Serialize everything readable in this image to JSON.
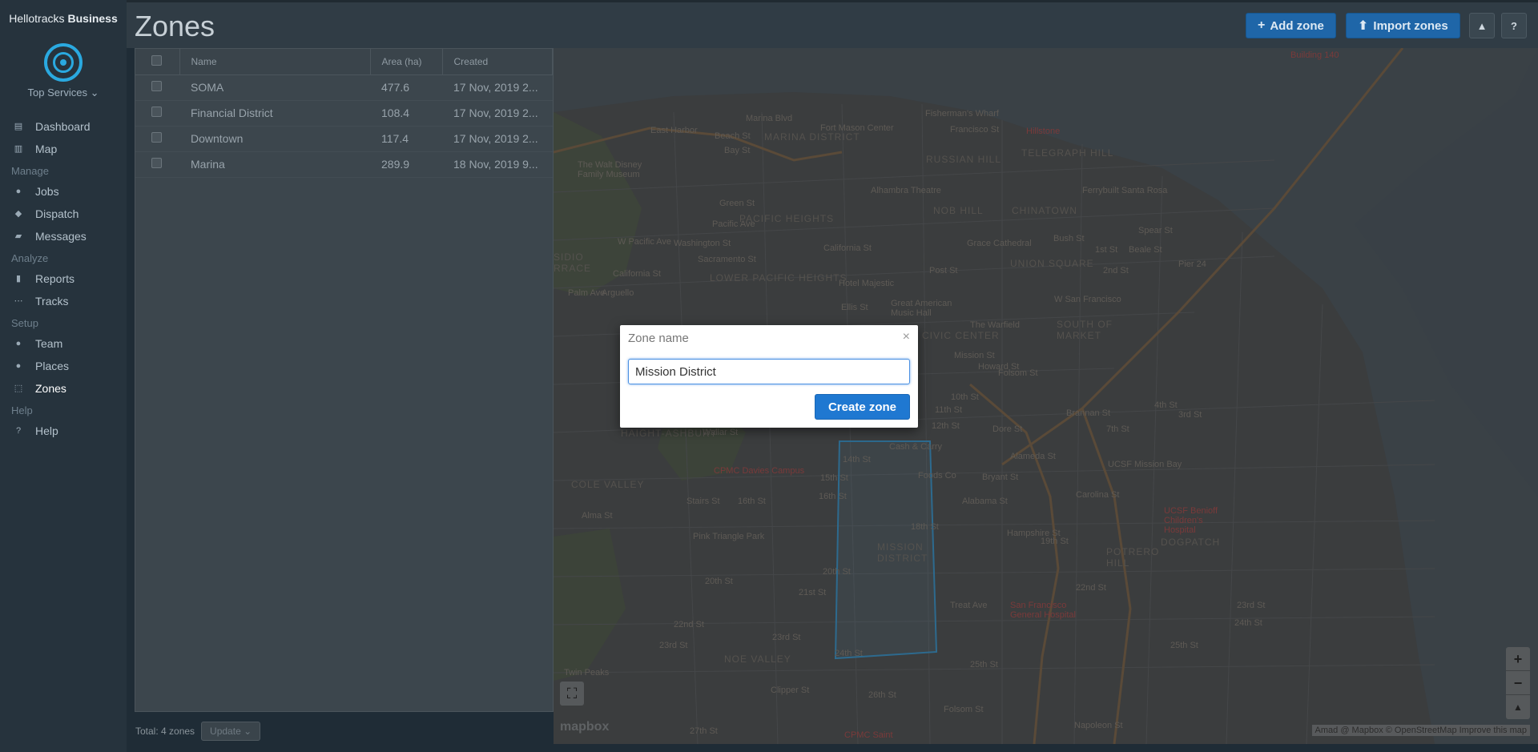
{
  "brand": {
    "prefix": "Hellotracks",
    "suffix": "Business"
  },
  "org": {
    "name": "Top Services ⌄"
  },
  "sidebar": {
    "sections": [
      {
        "label": "",
        "items": [
          {
            "label": "Dashboard",
            "icon": "dashboard-icon"
          },
          {
            "label": "Map",
            "icon": "map-icon"
          }
        ]
      },
      {
        "label": "Manage",
        "items": [
          {
            "label": "Jobs",
            "icon": "jobs-icon"
          },
          {
            "label": "Dispatch",
            "icon": "dispatch-icon"
          },
          {
            "label": "Messages",
            "icon": "messages-icon"
          }
        ]
      },
      {
        "label": "Analyze",
        "items": [
          {
            "label": "Reports",
            "icon": "reports-icon"
          },
          {
            "label": "Tracks",
            "icon": "tracks-icon"
          }
        ]
      },
      {
        "label": "Setup",
        "items": [
          {
            "label": "Team",
            "icon": "team-icon"
          },
          {
            "label": "Places",
            "icon": "places-icon"
          },
          {
            "label": "Zones",
            "icon": "zones-icon",
            "active": true
          }
        ]
      },
      {
        "label": "Help",
        "items": [
          {
            "label": "Help",
            "icon": "help-icon"
          }
        ]
      }
    ]
  },
  "header": {
    "title": "Zones",
    "add_zone": "Add zone",
    "import_zones": "Import zones",
    "bell_icon": "bell-icon",
    "help_label": "?"
  },
  "table": {
    "columns": [
      "Name",
      "Area (ha)",
      "Created"
    ],
    "rows": [
      {
        "name": "SOMA",
        "area": "477.6",
        "created": "17 Nov, 2019 2..."
      },
      {
        "name": "Financial District",
        "area": "108.4",
        "created": "17 Nov, 2019 2..."
      },
      {
        "name": "Downtown",
        "area": "117.4",
        "created": "17 Nov, 2019 2..."
      },
      {
        "name": "Marina",
        "area": "289.9",
        "created": "18 Nov, 2019 9..."
      }
    ],
    "total": "Total: 4 zones",
    "update": "Update ⌄"
  },
  "map": {
    "labels": {
      "marina_blvd": "Marina Blvd",
      "marina_district": "MARINA DISTRICT",
      "fort_mason": "Fort Mason Center",
      "fishermans_wharf": "Fisherman's Wharf",
      "francisco_st": "Francisco St",
      "hillstone": "Hillstone",
      "telegraph_hill": "TELEGRAPH HILL",
      "russian_hill": "RUSSIAN HILL",
      "east_harbor": "East Harbor",
      "beach_st": "Beach St",
      "bay_st": "Bay St",
      "disney_museum": "The Walt Disney Family Museum",
      "green_st": "Green St",
      "pacific_heights": "PACIFIC HEIGHTS",
      "nob_hill": "NOB HILL",
      "chinatown": "CHINATOWN",
      "alhambra": "Alhambra Theatre",
      "pacific_ave": "Pacific Ave",
      "washington_st": "Washington St",
      "sacramento_st": "Sacramento St",
      "w_pacific_ave": "W Pacific Ave",
      "california_st": "California St",
      "california_st2": "California St",
      "grace_cathedral": "Grace Cathedral",
      "bush_st": "Bush St",
      "lower_pac": "LOWER PACIFIC HEIGHTS",
      "union_square": "UNION SQUARE",
      "post_st": "Post St",
      "hotel_majestic": "Hotel Majestic",
      "ellis_st": "Ellis St",
      "great_american": "Great American Music Hall",
      "the_warfield": "The Warfield",
      "south_of_market": "SOUTH OF MARKET",
      "w_san_francisco": "W San Francisco",
      "civic_center": "CIVIC CENTER",
      "ferry_santa_rosa": "Ferrybuilt Santa Rosa",
      "spear_st": "Spear St",
      "beale_st": "Beale St",
      "pier24": "Pier 24",
      "building140": "Building 140",
      "haight_ashbury": "HAIGHT-ASHBURY",
      "cole_valley": "COLE VALLEY",
      "cpmc_davies": "CPMC Davies Campus",
      "wallar_st": "Wallar St",
      "cash_carry": "Cash & Carry",
      "foods_co": "Foods Co",
      "alameda_st": "Alameda St",
      "fourteenth_st": "14th St",
      "fifteenth_st": "15th St",
      "sixteenth_st": "16th St",
      "sixteenth_st2": "16th St",
      "eighteenth_st": "18th St",
      "twentieth_st": "20th St",
      "twentieth_st2": "20th St",
      "twentyfirst_st": "21st St",
      "twentysecond_st": "22nd St",
      "twentythird_st": "23rd St",
      "twentythird_st2": "23rd St",
      "twentyfourth_st": "24th St",
      "twentyfifth_st": "25th St",
      "twentysixth_st": "26th St",
      "twentyseventh_st": "27th St",
      "mission_district": "MISSION DISTRICT",
      "pink_triangle": "Pink Triangle Park",
      "alma_st": "Alma St",
      "noe_valley": "NOE VALLEY",
      "twin_peaks": "Twin Peaks",
      "clipper_st": "Clipper St",
      "cpmc_saint": "CPMC Saint",
      "ucsf_mission_bay": "UCSF Mission Bay",
      "ucsf_benioff": "UCSF Benioff Children's Hospital",
      "dogpatch": "DOGPATCH",
      "potrero_hill": "POTRERO HILL",
      "sf_general": "San Francisco General Hospital",
      "nineteenth_st": "19th St",
      "twentysecond_st2": "22nd St",
      "twentythird_st3": "23rd St",
      "twentyfourth_st2": "24th St",
      "twentyfifth_st2": "25th St",
      "third_st": "3rd St",
      "fourth_st": "4th St",
      "seventh_st": "7th St",
      "brannan_st": "Brannan St",
      "napoleon_st": "Napoleon St",
      "mission_st": "Mission St",
      "howard_st": "Howard St",
      "folsom_st": "Folsom St",
      "tenth_st": "10th St",
      "eleventh_st": "11th St",
      "twelfth_st": "12th St",
      "dore_st": "Dore St",
      "bryant_st": "Bryant St",
      "alabama_st": "Alabama St",
      "hampshire_st": "Hampshire St",
      "treat_ave": "Treat Ave",
      "carolina_st": "Carolina St",
      "folsom_st2": "Folsom St",
      "first_st": "1st St",
      "second_st": "2nd St",
      "stanley_st": "Stairs St",
      "sidio": "SIDIO",
      "rrace": "RRACE",
      "palm_ave": "Palm Ave",
      "arguello": "Arguello"
    },
    "fullscreen_icon": "fullscreen-icon",
    "mapbox_logo": "mapbox",
    "attribution": "Amad @ Mapbox © OpenStreetMap  Improve this map",
    "zoom_in": "+",
    "zoom_out": "−",
    "compass": "▲"
  },
  "modal": {
    "title": "Zone name",
    "close": "×",
    "input_value": "Mission District",
    "button": "Create zone"
  }
}
